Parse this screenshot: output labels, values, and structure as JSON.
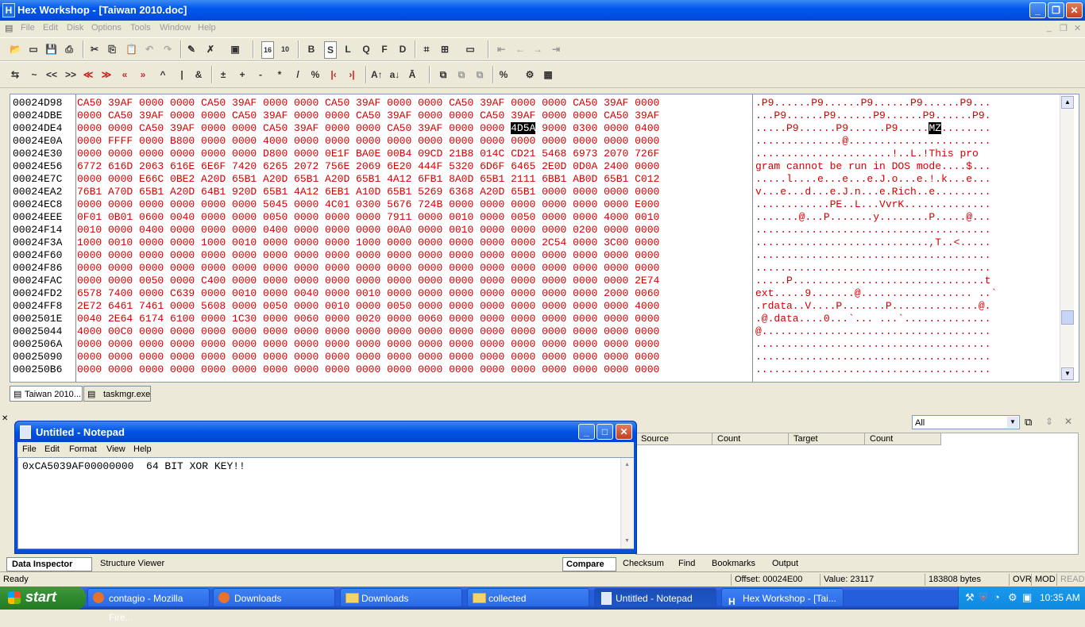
{
  "window": {
    "title": "Hex Workshop - [Taiwan 2010.doc]",
    "app_icon": "H"
  },
  "menu": [
    "File",
    "Edit",
    "Disk",
    "Options",
    "Tools",
    "Window",
    "Help"
  ],
  "toolbar1": [
    "B",
    "S",
    "L",
    "Q",
    "F",
    "D"
  ],
  "toolbar2_text": [
    "~",
    "<<",
    ">>",
    "^",
    "|",
    "&",
    "+",
    "-",
    "*",
    "/",
    "%"
  ],
  "hex": {
    "rows": [
      {
        "addr": "00024D98",
        "bytes": "CA50 39AF 0000 0000 CA50 39AF 0000 0000 CA50 39AF 0000 0000 CA50 39AF 0000 0000 CA50 39AF 0000",
        "ascii": ".P9......P9......P9......P9......P9..."
      },
      {
        "addr": "00024DBE",
        "bytes": "0000 CA50 39AF 0000 0000 CA50 39AF 0000 0000 CA50 39AF 0000 0000 CA50 39AF 0000 0000 CA50 39AF",
        "ascii": "...P9......P9......P9......P9......P9."
      },
      {
        "addr": "00024DE4",
        "bytes_pre": "0000 0000 CA50 39AF 0000 0000 CA50 39AF 0000 0000 CA50 39AF 0000 0000 ",
        "bytes_sel": "4D5A",
        "bytes_post": " 9000 0300 0000 0400",
        "ascii_pre": ".....P9......P9......P9.....",
        "ascii_sel": "MZ",
        "ascii_post": "........"
      },
      {
        "addr": "00024E0A",
        "bytes": "0000 FFFF 0000 B800 0000 0000 4000 0000 0000 0000 0000 0000 0000 0000 0000 0000 0000 0000 0000",
        "ascii": "..............@......................."
      },
      {
        "addr": "00024E30",
        "bytes": "0000 0000 0000 0000 0000 0000 D800 0000 0E1F BA0E 00B4 09CD 21B8 014C CD21 5468 6973 2070 726F",
        "ascii": "......................!..L.!This pro"
      },
      {
        "addr": "00024E56",
        "bytes": "6772 616D 2063 616E 6E6F 7420 6265 2072 756E 2069 6E20 444F 5320 6D6F 6465 2E0D 0D0A 2400 0000",
        "ascii": "gram cannot be run in DOS mode....$..."
      },
      {
        "addr": "00024E7C",
        "bytes": "0000 0000 E66C 0BE2 A20D 65B1 A20D 65B1 A20D 65B1 4A12 6FB1 8A0D 65B1 2111 6BB1 AB0D 65B1 C012",
        "ascii": ".....l....e...e...e.J.o...e.!.k...e..."
      },
      {
        "addr": "00024EA2",
        "bytes": "76B1 A70D 65B1 A20D 64B1 920D 65B1 4A12 6EB1 A10D 65B1 5269 6368 A20D 65B1 0000 0000 0000 0000",
        "ascii": "v...e...d...e.J.n...e.Rich..e........."
      },
      {
        "addr": "00024EC8",
        "bytes": "0000 0000 0000 0000 0000 0000 5045 0000 4C01 0300 5676 724B 0000 0000 0000 0000 0000 0000 E000",
        "ascii": "............PE..L...VvrK.............."
      },
      {
        "addr": "00024EEE",
        "bytes": "0F01 0B01 0600 0040 0000 0000 0050 0000 0000 0000 7911 0000 0010 0000 0050 0000 0000 4000 0010",
        "ascii": ".......@...P.......y........P.....@..."
      },
      {
        "addr": "00024F14",
        "bytes": "0010 0000 0400 0000 0000 0000 0400 0000 0000 0000 00A0 0000 0010 0000 0000 0000 0200 0000 0000",
        "ascii": "......................................"
      },
      {
        "addr": "00024F3A",
        "bytes": "1000 0010 0000 0000 1000 0010 0000 0000 0000 1000 0000 0000 0000 0000 0000 2C54 0000 3C00 0000",
        "ascii": "............................,T..<....."
      },
      {
        "addr": "00024F60",
        "bytes": "0000 0000 0000 0000 0000 0000 0000 0000 0000 0000 0000 0000 0000 0000 0000 0000 0000 0000 0000",
        "ascii": "......................................"
      },
      {
        "addr": "00024F86",
        "bytes": "0000 0000 0000 0000 0000 0000 0000 0000 0000 0000 0000 0000 0000 0000 0000 0000 0000 0000 0000",
        "ascii": "......................................"
      },
      {
        "addr": "00024FAC",
        "bytes": "0000 0000 0050 0000 C400 0000 0000 0000 0000 0000 0000 0000 0000 0000 0000 0000 0000 0000 2E74",
        "ascii": ".....P...............................t"
      },
      {
        "addr": "00024FD2",
        "bytes": "6578 7400 0000 C639 0000 0010 0000 0040 0000 0010 0000 0000 0000 0000 0000 0000 0000 2000 0060",
        "ascii": "ext.....9.......@.................. ..`"
      },
      {
        "addr": "00024FF8",
        "bytes": "2E72 6461 7461 0000 5608 0000 0050 0000 0010 0000 0050 0000 0000 0000 0000 0000 0000 0000 4000",
        "ascii": ".rdata..V....P.......P..............@."
      },
      {
        "addr": "0002501E",
        "bytes": "0040 2E64 6174 6100 0000 1C30 0000 0060 0000 0020 0000 0060 0000 0000 0000 0000 0000 0000 0000",
        "ascii": ".@.data....0...`... ...`.............."
      },
      {
        "addr": "00025044",
        "bytes": "4000 00C0 0000 0000 0000 0000 0000 0000 0000 0000 0000 0000 0000 0000 0000 0000 0000 0000 0000",
        "ascii": "@....................................."
      },
      {
        "addr": "0002506A",
        "bytes": "0000 0000 0000 0000 0000 0000 0000 0000 0000 0000 0000 0000 0000 0000 0000 0000 0000 0000 0000",
        "ascii": "......................................"
      },
      {
        "addr": "00025090",
        "bytes": "0000 0000 0000 0000 0000 0000 0000 0000 0000 0000 0000 0000 0000 0000 0000 0000 0000 0000 0000",
        "ascii": "......................................"
      },
      {
        "addr": "000250B6",
        "bytes": "0000 0000 0000 0000 0000 0000 0000 0000 0000 0000 0000 0000 0000 0000 0000 0000 0000 0000 0000",
        "ascii": "......................................"
      }
    ]
  },
  "doc_tabs": [
    "Taiwan 2010...",
    "taskmgr.exe"
  ],
  "notepad": {
    "title": "Untitled - Notepad",
    "menu": [
      "File",
      "Edit",
      "Format",
      "View",
      "Help"
    ],
    "content": "0xCA5039AF00000000  64 BIT XOR KEY!!"
  },
  "lower_left_tabs": [
    "Data Inspector",
    "Structure Viewer"
  ],
  "compare": {
    "filter": "All",
    "columns": [
      "Source",
      "Count",
      "Target",
      "Count"
    ]
  },
  "lower_right_tabs": [
    "Compare",
    "Checksum",
    "Find",
    "Bookmarks",
    "Output"
  ],
  "status": {
    "ready": "Ready",
    "offset": "Offset: 00024E00",
    "value": "Value: 23117",
    "size": "183808 bytes",
    "ovr": "OVR",
    "mod": "MOD",
    "read": "READ"
  },
  "taskbar": {
    "start": "start",
    "tasks": [
      "contagio - Mozilla Fire...",
      "Downloads",
      "Downloads",
      "collected",
      "Untitled - Notepad",
      "Hex Workshop - [Tai..."
    ],
    "clock": "10:35 AM"
  },
  "colors": {
    "hex_text": "#d20000",
    "titlebar": "#0058ee",
    "taskbar": "#245edb",
    "start": "#2f8a2f"
  }
}
